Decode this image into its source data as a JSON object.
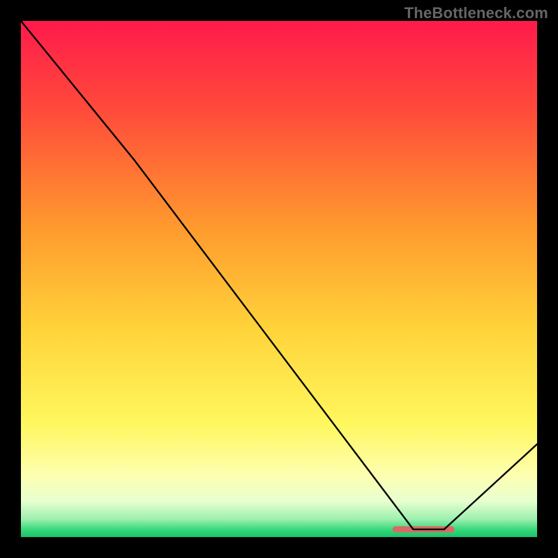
{
  "watermark": "TheBottleneck.com",
  "chart_data": {
    "type": "line",
    "title": "",
    "xlabel": "",
    "ylabel": "",
    "xlim": [
      0,
      100
    ],
    "ylim": [
      0,
      100
    ],
    "grid": false,
    "legend": false,
    "series": [
      {
        "name": "curve",
        "color": "#000000",
        "x": [
          0,
          22,
          76,
          82,
          100
        ],
        "values": [
          100,
          73,
          1.5,
          1.5,
          18
        ]
      }
    ],
    "annotations": [
      {
        "name": "marker-strip",
        "shape": "rounded-rect",
        "x_center": 78,
        "y_center": 1.5,
        "width": 12,
        "height": 1.2,
        "color": "#d86a62"
      }
    ],
    "background_gradient": {
      "stops": [
        {
          "offset": 0.0,
          "color": "#ff1a4b"
        },
        {
          "offset": 0.18,
          "color": "#ff4d3a"
        },
        {
          "offset": 0.4,
          "color": "#ff9a2e"
        },
        {
          "offset": 0.6,
          "color": "#ffd43a"
        },
        {
          "offset": 0.78,
          "color": "#fff75e"
        },
        {
          "offset": 0.88,
          "color": "#fdffb0"
        },
        {
          "offset": 0.93,
          "color": "#e8ffcf"
        },
        {
          "offset": 0.965,
          "color": "#9ef0b0"
        },
        {
          "offset": 0.985,
          "color": "#39d97d"
        },
        {
          "offset": 1.0,
          "color": "#18c26a"
        }
      ]
    }
  }
}
